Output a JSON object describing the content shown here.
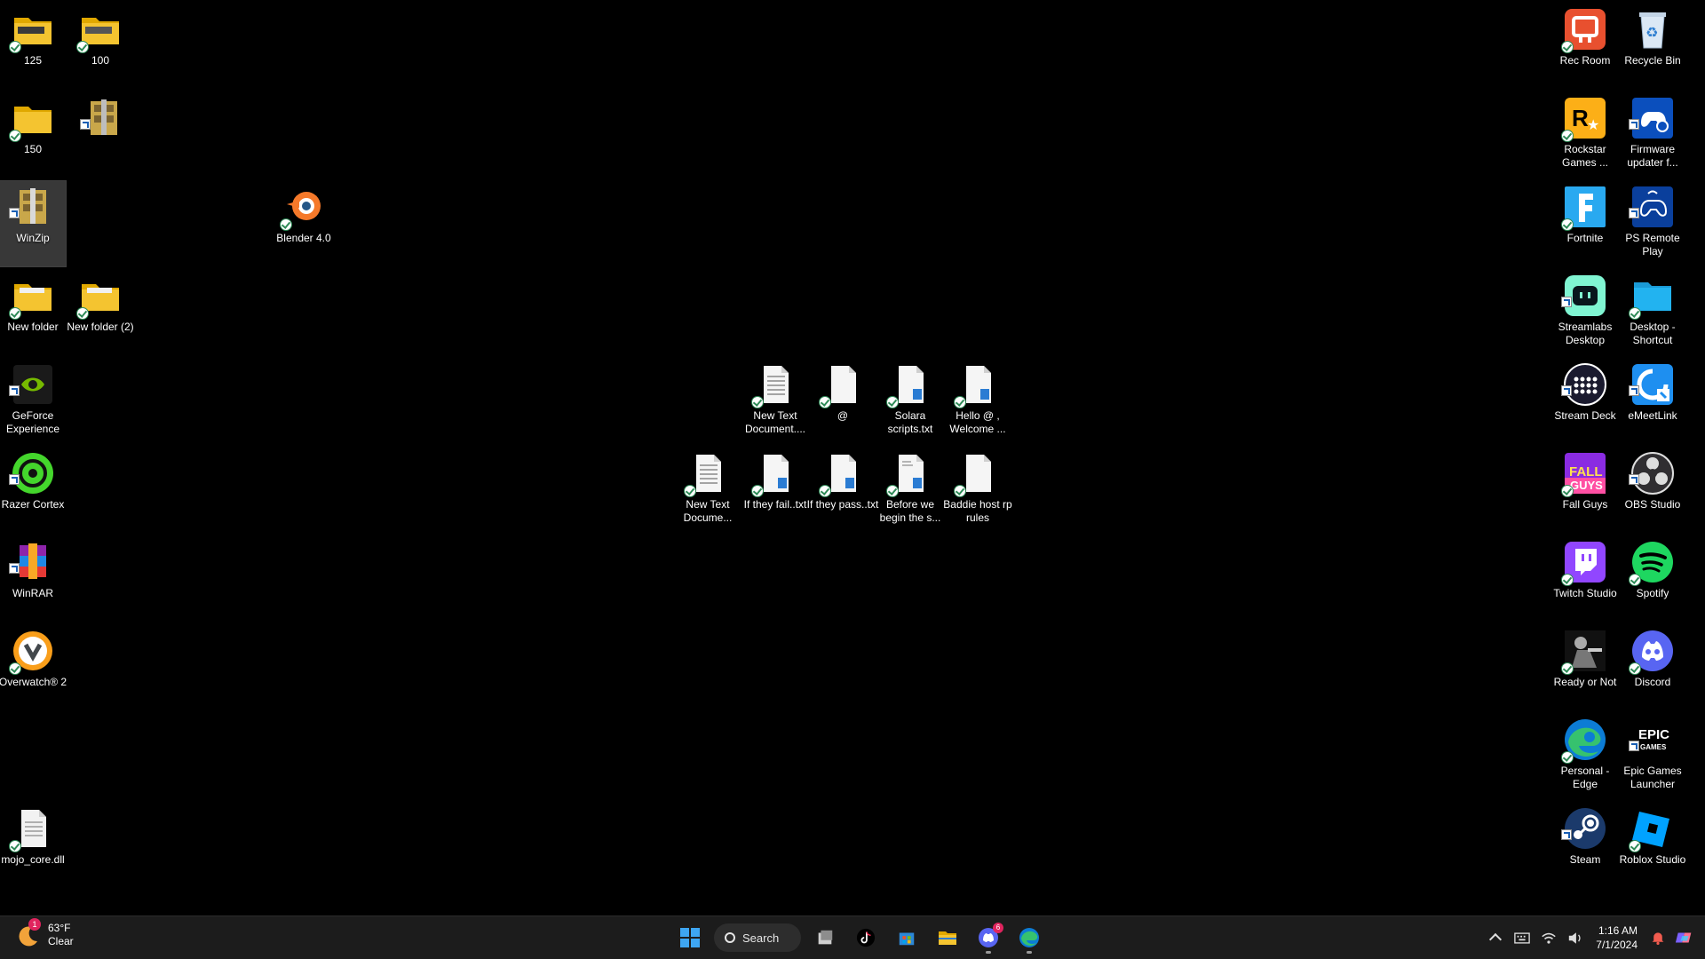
{
  "desktop": {
    "icons": [
      {
        "label": "125",
        "icon": "folder-icon"
      },
      {
        "label": "100",
        "icon": "folder-icon"
      },
      {
        "label": "150",
        "icon": "folder-icon"
      },
      {
        "label": "",
        "icon": "archive-icon"
      },
      {
        "label": "WinZip",
        "icon": "winzip-icon"
      },
      {
        "label": "Blender 4.0",
        "icon": "blender-icon"
      },
      {
        "label": "New folder",
        "icon": "folder-icon"
      },
      {
        "label": "New folder (2)",
        "icon": "folder-icon"
      },
      {
        "label": "GeForce Experience",
        "icon": "geforce-icon"
      },
      {
        "label": "Razer Cortex",
        "icon": "razer-cortex-icon"
      },
      {
        "label": "WinRAR",
        "icon": "winrar-icon"
      },
      {
        "label": "Overwatch® 2",
        "icon": "overwatch-icon"
      },
      {
        "label": "mojo_core.dll",
        "icon": "file-icon"
      },
      {
        "label": "New Text Document....",
        "icon": "text-file-icon"
      },
      {
        "label": "@",
        "icon": "text-file-icon"
      },
      {
        "label": "Solara scripts.txt",
        "icon": "text-file-icon"
      },
      {
        "label": "Hello @ , Welcome ...",
        "icon": "text-file-icon"
      },
      {
        "label": "New Text Docume...",
        "icon": "text-file-icon"
      },
      {
        "label": "If they fail..txt",
        "icon": "text-file-icon"
      },
      {
        "label": "If they pass..txt",
        "icon": "text-file-icon"
      },
      {
        "label": "Before we begin the s...",
        "icon": "text-file-icon"
      },
      {
        "label": "Baddie host rp rules",
        "icon": "text-file-icon"
      },
      {
        "label": "Rec Room",
        "icon": "rec-room-icon"
      },
      {
        "label": "Recycle Bin",
        "icon": "recycle-bin-icon"
      },
      {
        "label": "Rockstar Games ...",
        "icon": "rockstar-icon"
      },
      {
        "label": "Firmware updater f...",
        "icon": "playstation-firmware-icon"
      },
      {
        "label": "Fortnite",
        "icon": "fortnite-icon"
      },
      {
        "label": "PS Remote Play",
        "icon": "ps-remote-play-icon"
      },
      {
        "label": "Streamlabs Desktop",
        "icon": "streamlabs-icon"
      },
      {
        "label": "Desktop - Shortcut",
        "icon": "folder-icon"
      },
      {
        "label": "Stream Deck",
        "icon": "stream-deck-icon"
      },
      {
        "label": "eMeetLink",
        "icon": "emeetlink-icon"
      },
      {
        "label": "Fall Guys",
        "icon": "fall-guys-icon"
      },
      {
        "label": "OBS Studio",
        "icon": "obs-icon"
      },
      {
        "label": "Twitch Studio",
        "icon": "twitch-icon"
      },
      {
        "label": "Spotify",
        "icon": "spotify-icon"
      },
      {
        "label": "Ready or Not",
        "icon": "ready-or-not-icon"
      },
      {
        "label": "Discord",
        "icon": "discord-icon"
      },
      {
        "label": "Personal - Edge",
        "icon": "edge-icon"
      },
      {
        "label": "Epic Games Launcher",
        "icon": "epic-games-icon"
      },
      {
        "label": "Steam",
        "icon": "steam-icon"
      },
      {
        "label": "Roblox Studio",
        "icon": "roblox-studio-icon"
      }
    ]
  },
  "taskbar": {
    "weather": {
      "temp": "63°F",
      "condition": "Clear",
      "badge": "1"
    },
    "search_label": "Search",
    "apps": [
      {
        "name": "start",
        "icon": "windows-start-icon"
      },
      {
        "name": "search",
        "icon": "search-icon"
      },
      {
        "name": "task-view",
        "icon": "task-view-icon"
      },
      {
        "name": "tiktok",
        "icon": "tiktok-icon"
      },
      {
        "name": "store",
        "icon": "microsoft-store-icon"
      },
      {
        "name": "file-explorer",
        "icon": "file-explorer-icon"
      },
      {
        "name": "discord",
        "icon": "discord-icon",
        "badge": "6"
      },
      {
        "name": "edge",
        "icon": "edge-icon"
      }
    ],
    "time": "1:16 AM",
    "date": "7/1/2024",
    "colors": {
      "taskbar_bg": "#1c1c1c",
      "folder_yellow": "#f4c430",
      "sync_green": "#2e8b57"
    }
  }
}
